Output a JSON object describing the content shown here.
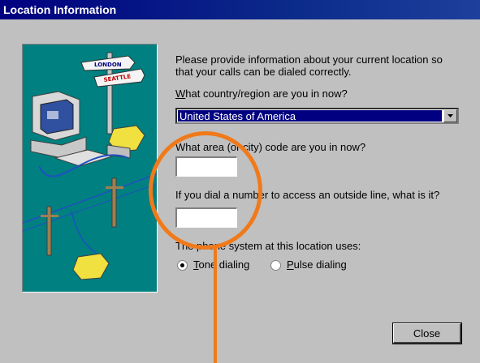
{
  "window": {
    "title": "Location Information"
  },
  "intro": {
    "line1": "Please provide information about your current location so",
    "line2": "that your calls can be dialed correctly."
  },
  "country": {
    "label": "What country/region are you in now?",
    "selected": "United States of America"
  },
  "area_code": {
    "label": "What area (or city) code are you in now?",
    "value": ""
  },
  "outside_line": {
    "label": "If you dial a number to access an outside line, what is it?",
    "value": ""
  },
  "phone_system": {
    "label": "The phone system at this location uses:",
    "tone": "Tone dialing",
    "pulse": "Pulse dialing",
    "selected": "tone"
  },
  "buttons": {
    "close": "Close"
  },
  "illustration": {
    "sign1": "LONDON",
    "sign2": "SEATTLE"
  },
  "colors": {
    "titlebar": "#000080",
    "illustration_bg": "#008080",
    "annotation": "#f07a1a"
  }
}
